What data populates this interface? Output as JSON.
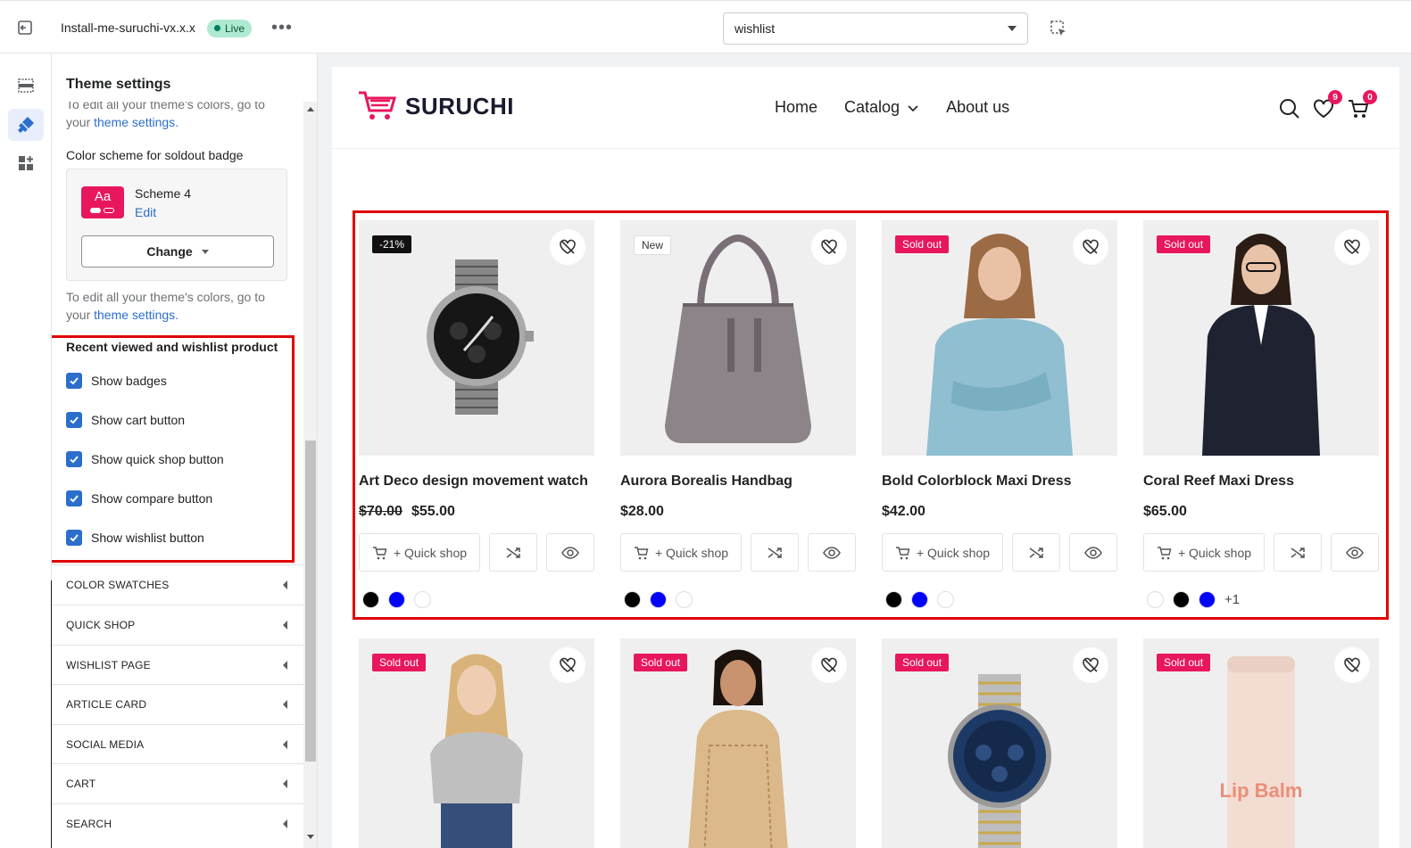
{
  "topbar": {
    "theme_name": "Install-me-suruchi-vx.x.x",
    "live_label": "Live",
    "more_label": "•••",
    "page_select_value": "wishlist"
  },
  "panel": {
    "title": "Theme settings",
    "cut_text": "To edit all your theme's colors, go to your",
    "cut_link": "theme settings.",
    "soldout_label": "Color scheme for soldout badge",
    "scheme_swatch_text": "Aa",
    "scheme_name": "Scheme 4",
    "scheme_edit": "Edit",
    "change_label": "Change",
    "edit_text": "To edit all your theme's colors, go to your",
    "edit_link": "theme settings.",
    "wishlist_section_title": "Recent viewed and wishlist product",
    "checkboxes": [
      "Show badges",
      "Show cart button",
      "Show quick shop button",
      "Show compare button",
      "Show wishlist button"
    ],
    "accordions": [
      "COLOR SWATCHES",
      "QUICK SHOP",
      "WISHLIST PAGE",
      "ARTICLE CARD",
      "SOCIAL MEDIA",
      "CART",
      "SEARCH"
    ]
  },
  "store": {
    "logo_text": "SURUCHI",
    "nav": [
      "Home",
      "Catalog",
      "About us"
    ],
    "wishlist_count": "9",
    "cart_count": "0",
    "quick_shop_label": "+ Quick shop",
    "products": [
      {
        "badge": "-21%",
        "badge_type": "sale",
        "title": "Art Deco design movement watch",
        "old_price": "$70.00",
        "price": "$55.00",
        "swatches": [
          "#000000",
          "#0000ff",
          "#ffffff"
        ],
        "more": ""
      },
      {
        "badge": "New",
        "badge_type": "new",
        "title": "Aurora Borealis Handbag",
        "old_price": "",
        "price": "$28.00",
        "swatches": [
          "#000000",
          "#0000ff",
          "#ffffff"
        ],
        "more": ""
      },
      {
        "badge": "Sold out",
        "badge_type": "soldout",
        "title": "Bold Colorblock Maxi Dress",
        "old_price": "",
        "price": "$42.00",
        "swatches": [
          "#000000",
          "#0000ff",
          "#ffffff"
        ],
        "more": ""
      },
      {
        "badge": "Sold out",
        "badge_type": "soldout",
        "title": "Coral Reef Maxi Dress",
        "old_price": "",
        "price": "$65.00",
        "swatches": [
          "#ffffff",
          "#000000",
          "#0000ff"
        ],
        "more": "+1"
      }
    ],
    "second_row_badges": [
      "Sold out",
      "Sold out",
      "Sold out",
      "Sold out"
    ],
    "lip_balm_text": "Lip Balm"
  },
  "colors": {
    "accent_pink": "#e8175d",
    "highlight_red": "#e00000",
    "link_blue": "#2c6ecb"
  }
}
